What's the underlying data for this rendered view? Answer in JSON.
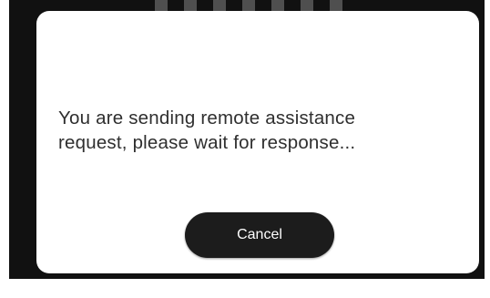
{
  "dialog": {
    "message": "You are sending remote assistance\nrequest, please wait for response...",
    "cancel_label": "Cancel"
  },
  "colors": {
    "backdrop": "#111111",
    "dialog_background": "#ffffff",
    "button_background": "#1c1c1c",
    "button_text": "#ffffff",
    "message_text": "#2f2f2f"
  }
}
